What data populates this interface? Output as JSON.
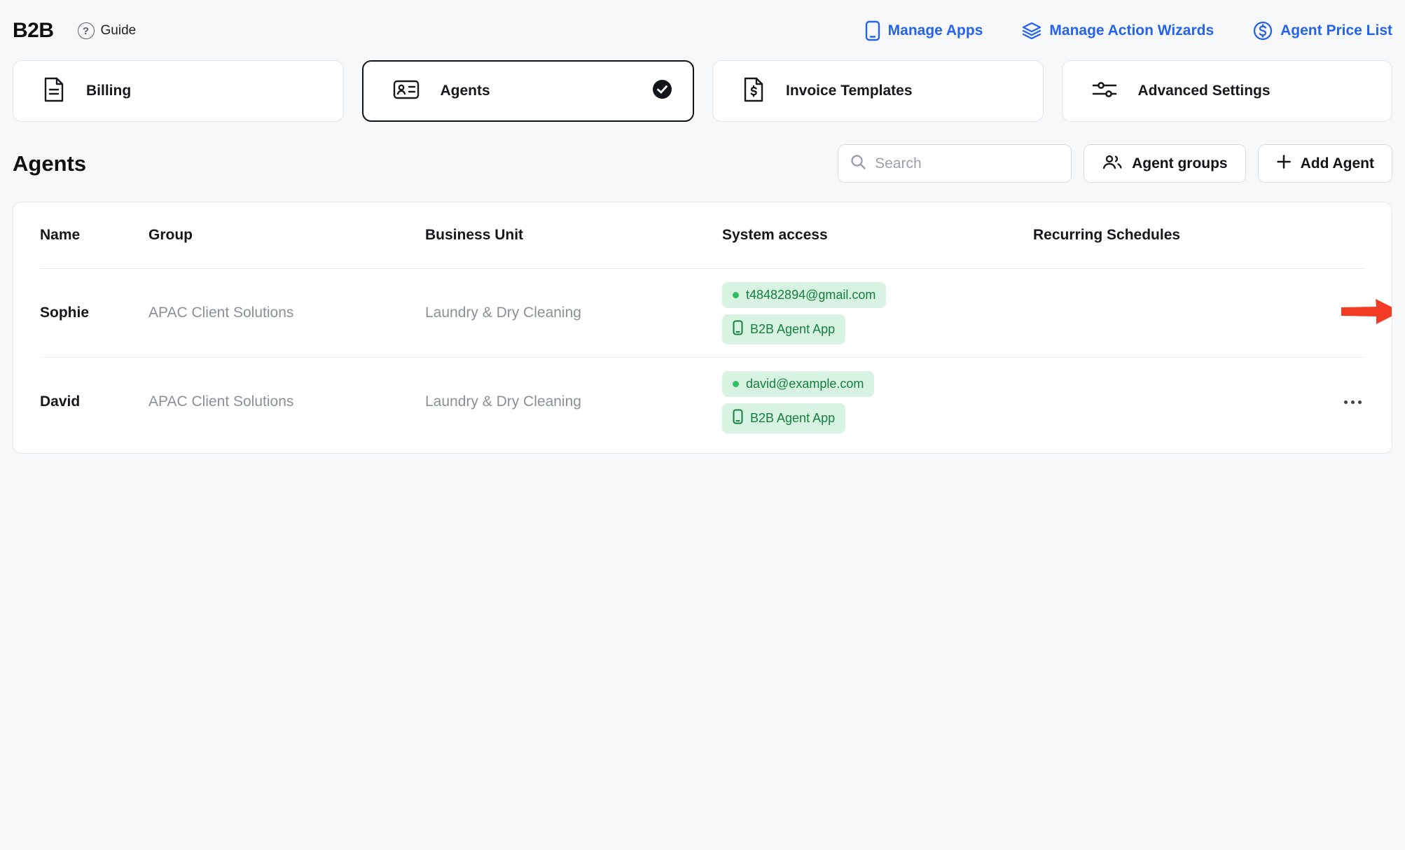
{
  "header": {
    "logo": "B2B",
    "guide_label": "Guide",
    "links": [
      {
        "label": "Manage Apps"
      },
      {
        "label": "Manage Action Wizards"
      },
      {
        "label": "Agent Price List"
      }
    ]
  },
  "tabs": [
    {
      "label": "Billing",
      "icon": "billing-document-icon",
      "selected": false
    },
    {
      "label": "Agents",
      "icon": "id-card-icon",
      "selected": true
    },
    {
      "label": "Invoice Templates",
      "icon": "invoice-document-icon",
      "selected": false
    },
    {
      "label": "Advanced Settings",
      "icon": "sliders-icon",
      "selected": false
    }
  ],
  "toolbar": {
    "title": "Agents",
    "search_placeholder": "Search",
    "agent_groups_label": "Agent groups",
    "add_agent_label": "Add Agent"
  },
  "table": {
    "columns": [
      "Name",
      "Group",
      "Business Unit",
      "System access",
      "Recurring Schedules"
    ],
    "rows": [
      {
        "name": "Sophie",
        "group": "APAC Client Solutions",
        "business_unit": "Laundry & Dry Cleaning",
        "email": "t48482894@gmail.com",
        "app": "B2B Agent App",
        "recurring": "",
        "has_arrow_annotation": true
      },
      {
        "name": "David",
        "group": "APAC Client Solutions",
        "business_unit": "Laundry & Dry Cleaning",
        "email": "david@example.com",
        "app": "B2B Agent App",
        "recurring": "",
        "has_arrow_annotation": false
      }
    ]
  },
  "colors": {
    "link_blue": "#2563eb",
    "badge_bg": "#d8f3e2",
    "badge_text": "#157f3d",
    "status_dot": "#2fbf5f",
    "annotation_arrow": "#f23b25",
    "selected_tab_border": "#101418",
    "page_bg": "#f7f8f9"
  }
}
